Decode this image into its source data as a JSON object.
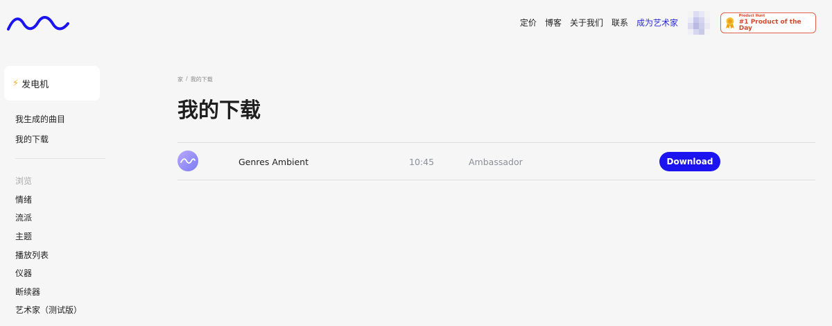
{
  "header": {
    "nav": [
      {
        "label": "定价"
      },
      {
        "label": "博客"
      },
      {
        "label": "关于我们"
      },
      {
        "label": "联系"
      },
      {
        "label": "成为艺术家",
        "accent": true
      }
    ],
    "product_hunt": {
      "small": "Product Hunt",
      "big": "#1 Product of the Day"
    },
    "colors": {
      "brand": "#1b14f0",
      "accent_link": "#2929e0",
      "badge": "#d04a2d"
    }
  },
  "sidebar": {
    "generator": {
      "icon": "lightning-icon",
      "label": "发电机"
    },
    "primary": [
      {
        "label": "我生成的曲目"
      },
      {
        "label": "我的下载"
      }
    ],
    "browse_heading": "浏览",
    "browse": [
      {
        "label": "情绪"
      },
      {
        "label": "流派"
      },
      {
        "label": "主题"
      },
      {
        "label": "播放列表"
      },
      {
        "label": "仪器"
      },
      {
        "label": "断续器"
      },
      {
        "label": "艺术家（测试版）"
      }
    ]
  },
  "main": {
    "breadcrumb": [
      "家",
      "/",
      "我的下载"
    ],
    "title": "我的下载",
    "tracks": [
      {
        "name": "Genres Ambient",
        "duration": "10:45",
        "license": "Ambassador",
        "action": "Download"
      }
    ]
  }
}
